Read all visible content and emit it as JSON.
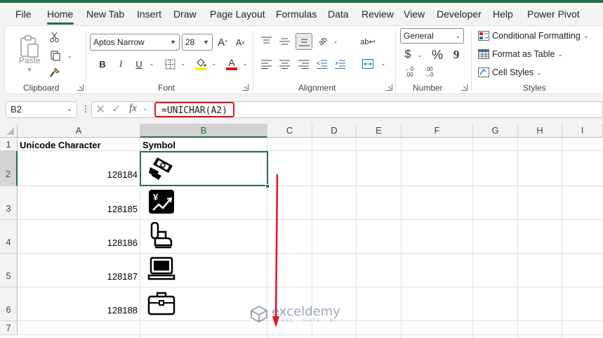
{
  "tabs": [
    "File",
    "Home",
    "New Tab",
    "Insert",
    "Draw",
    "Page Layout",
    "Formulas",
    "Data",
    "Review",
    "View",
    "Developer",
    "Help",
    "Power Pivot"
  ],
  "ribbon": {
    "clipboard": {
      "paste_label": "Paste",
      "group_label": "Clipboard"
    },
    "font": {
      "font_name": "Aptos Narrow",
      "font_size": "28",
      "group_label": "Font",
      "bold": "B",
      "italic": "I",
      "underline": "U"
    },
    "alignment": {
      "group_label": "Alignment"
    },
    "number": {
      "format": "General",
      "group_label": "Number",
      "currency": "$",
      "percent": "%",
      "comma": "9"
    },
    "styles": {
      "conditional": "Conditional Formatting",
      "format_table": "Format as Table",
      "cell_styles": "Cell Styles",
      "group_label": "Styles"
    }
  },
  "formula_bar": {
    "name_box": "B2",
    "fx": "fx",
    "formula": "=UNICHAR(A2)"
  },
  "columns": [
    "A",
    "B",
    "C",
    "D",
    "E",
    "F",
    "G",
    "H",
    "I"
  ],
  "rows": [
    "1",
    "2",
    "3",
    "4",
    "5",
    "6",
    "7"
  ],
  "sheet": {
    "header_a": "Unicode  Character",
    "header_b": "Symbol",
    "values": [
      "128184",
      "128185",
      "128186",
      "128187",
      "128188"
    ]
  },
  "icons": [
    "money-with-wings-icon",
    "chart-yen-icon",
    "seat-icon",
    "laptop-icon",
    "briefcase-icon"
  ],
  "watermark": {
    "name": "exceldemy",
    "sub": "EXCEL · DATA · BI"
  },
  "colors": {
    "excel_green": "#1f7244",
    "highlight_red": "#e0151b",
    "font_color_red": "#e0151b",
    "fill_yellow": "#ffeb00"
  }
}
